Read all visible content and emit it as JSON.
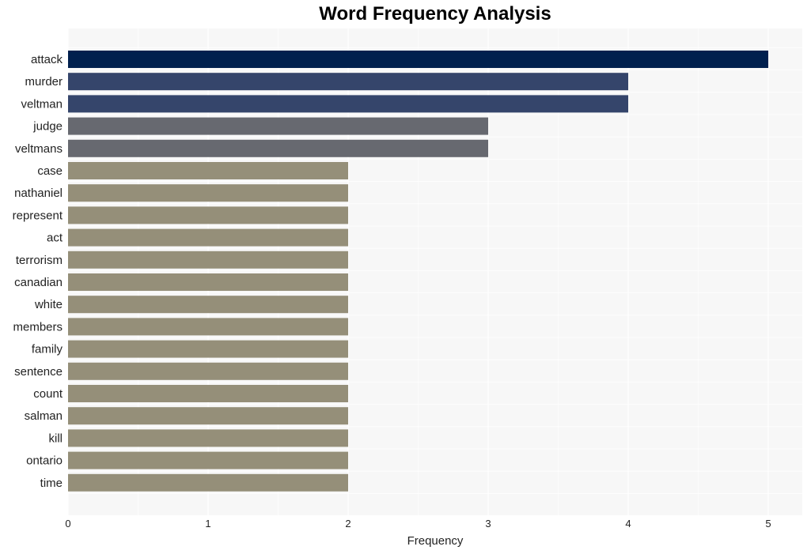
{
  "chart_data": {
    "type": "bar",
    "orientation": "horizontal",
    "title": "Word Frequency Analysis",
    "xlabel": "Frequency",
    "ylabel": "",
    "xlim": [
      0,
      5.24
    ],
    "xticks": [
      0,
      1,
      2,
      3,
      4,
      5
    ],
    "grid": true,
    "categories": [
      "attack",
      "murder",
      "veltman",
      "judge",
      "veltmans",
      "case",
      "nathaniel",
      "represent",
      "act",
      "terrorism",
      "canadian",
      "white",
      "members",
      "family",
      "sentence",
      "count",
      "salman",
      "kill",
      "ontario",
      "time"
    ],
    "values": [
      5,
      4,
      4,
      3,
      3,
      2,
      2,
      2,
      2,
      2,
      2,
      2,
      2,
      2,
      2,
      2,
      2,
      2,
      2,
      2
    ],
    "colors": {
      "5": "#00204e",
      "4": "#35456b",
      "3": "#676970",
      "2": "#958f79"
    },
    "background": "#f7f7f7"
  }
}
